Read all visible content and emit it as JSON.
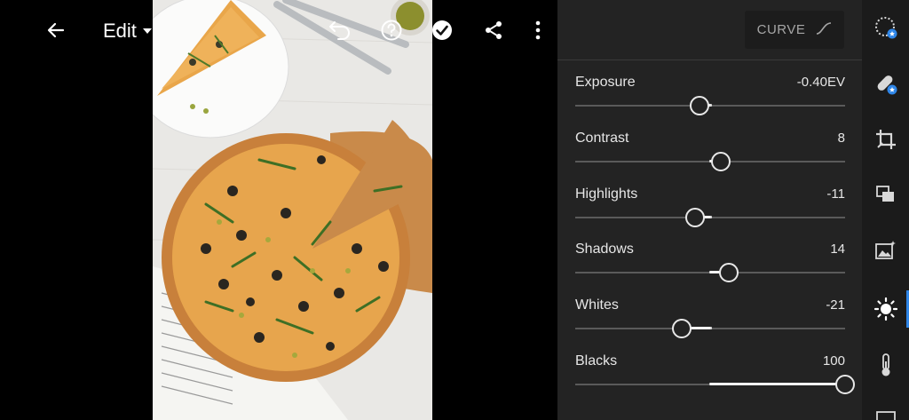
{
  "toolbar": {
    "back_icon": "arrow-left-icon",
    "edit_label": "Edit",
    "undo_icon": "undo-icon",
    "help_icon": "help-icon",
    "done_icon": "checkmark-circle-icon",
    "share_icon": "share-icon",
    "more_icon": "more-vertical-icon"
  },
  "panel": {
    "curve_label": "CURVE",
    "sliders": [
      {
        "label": "Exposure",
        "value": "-0.40EV",
        "position": 0.46
      },
      {
        "label": "Contrast",
        "value": "8",
        "position": 0.54
      },
      {
        "label": "Highlights",
        "value": "-11",
        "position": 0.445
      },
      {
        "label": "Shadows",
        "value": "14",
        "position": 0.57
      },
      {
        "label": "Whites",
        "value": "-21",
        "position": 0.395
      },
      {
        "label": "Blacks",
        "value": "100",
        "position": 1.0
      }
    ]
  },
  "tools": [
    {
      "name": "presets-icon",
      "active": false
    },
    {
      "name": "healing-bandage-icon",
      "active": false
    },
    {
      "name": "crop-icon",
      "active": false
    },
    {
      "name": "layers-icon",
      "active": false
    },
    {
      "name": "auto-enhance-icon",
      "active": false
    },
    {
      "name": "light-sun-icon",
      "active": true
    },
    {
      "name": "color-thermometer-icon",
      "active": false
    },
    {
      "name": "effects-icon",
      "active": false
    }
  ],
  "colors": {
    "accent": "#2f86e8",
    "panel_bg": "#232323",
    "strip_bg": "#1b1b1b"
  }
}
